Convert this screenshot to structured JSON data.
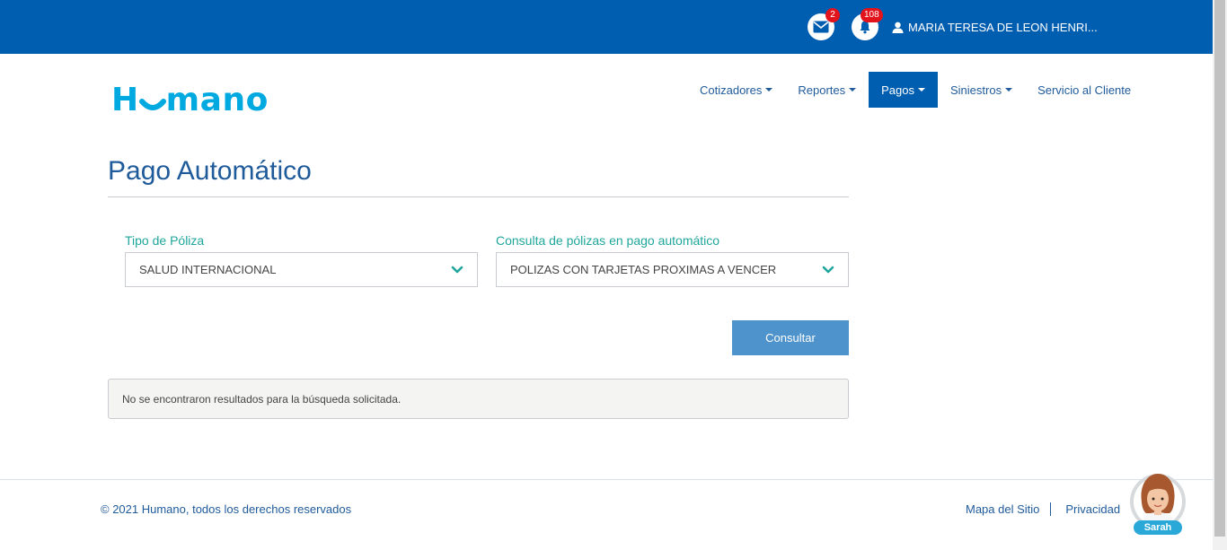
{
  "header": {
    "mail_badge": "2",
    "notifications_badge": "108",
    "user_name": "MARIA TERESA DE LEON HENRI..."
  },
  "logo": {
    "text_left": "H",
    "text_right": "mano"
  },
  "nav": {
    "items": [
      {
        "label": "Cotizadores",
        "dropdown": true,
        "active": false
      },
      {
        "label": "Reportes",
        "dropdown": true,
        "active": false
      },
      {
        "label": "Pagos",
        "dropdown": true,
        "active": true
      },
      {
        "label": "Siniestros",
        "dropdown": true,
        "active": false
      },
      {
        "label": "Servicio al Cliente",
        "dropdown": false,
        "active": false
      }
    ]
  },
  "page": {
    "title": "Pago Automático",
    "policy_type_label": "Tipo de Póliza",
    "policy_type_value": "SALUD INTERNACIONAL",
    "query_label": "Consulta de pólizas en pago automático",
    "query_value": "POLIZAS CON TARJETAS PROXIMAS A VENCER",
    "submit_label": "Consultar",
    "no_results": "No se encontraron resultados para la búsqueda solicitada."
  },
  "footer": {
    "copyright": "© 2021 Humano, todos los derechos reservados",
    "sitemap": "Mapa del Sitio",
    "privacy": "Privacidad"
  },
  "assistant": {
    "name": "Sarah"
  },
  "colors": {
    "brand_blue": "#005eb0",
    "logo_cyan": "#00a9e0",
    "label_teal": "#1fa69b",
    "button_blue": "#4f93cc",
    "badge_red": "#e3131c"
  },
  "icons": {
    "mail": "envelope-icon",
    "notifications": "bell-icon",
    "user": "user-icon",
    "select_chevron": "chevron-down-icon"
  }
}
